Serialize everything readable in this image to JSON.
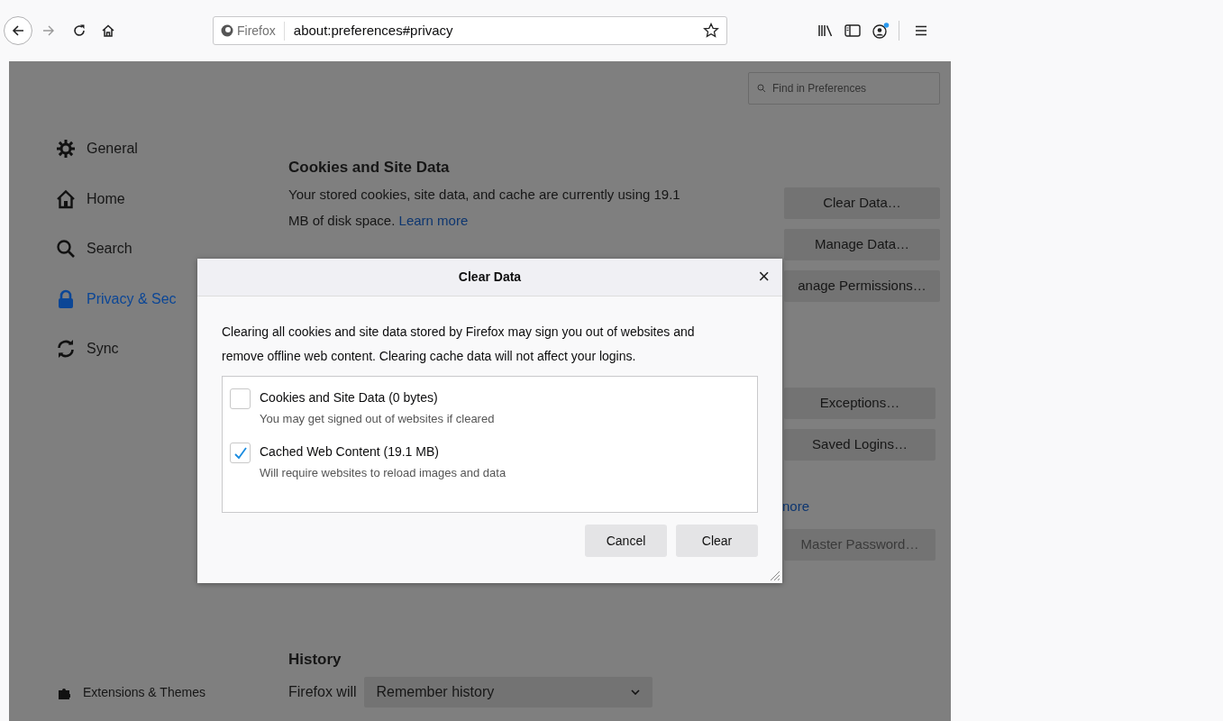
{
  "toolbar": {
    "identity": "Firefox",
    "url": "about:preferences#privacy"
  },
  "search": {
    "placeholder": "Find in Preferences"
  },
  "sidebar": {
    "items": [
      {
        "label": "General",
        "kind": "gear",
        "selected": false
      },
      {
        "label": "Home",
        "kind": "home",
        "selected": false
      },
      {
        "label": "Search",
        "kind": "search",
        "selected": false
      },
      {
        "label": "Privacy & Sec",
        "kind": "lock",
        "selected": true
      },
      {
        "label": "Sync",
        "kind": "sync",
        "selected": false
      }
    ],
    "footer": "Extensions & Themes"
  },
  "cookies": {
    "heading": "Cookies and Site Data",
    "text": "Your stored cookies, site data, and cache are currently using 19.1 MB of disk space.",
    "link": "Learn more",
    "buttons": [
      "Clear Data…",
      "Manage Data…",
      "anage Permissions…"
    ]
  },
  "logins": {
    "buttons": [
      "Exceptions…",
      "Saved Logins…"
    ],
    "link": "nore",
    "master_button": {
      "label": "Master Password…",
      "disabled": true
    }
  },
  "history": {
    "heading": "History",
    "label": "Firefox will",
    "select": "Remember history"
  },
  "dialog": {
    "title": "Clear Data",
    "close": "×",
    "text": "Clearing all cookies and site data stored by Firefox may sign you out of websites and remove offline web content. Clearing cache data will not affect your logins.",
    "options": [
      {
        "label": "Cookies and Site Data (0 bytes)",
        "description": "You may get signed out of websites if cleared",
        "checked": false
      },
      {
        "label": "Cached Web Content (19.1 MB)",
        "description": "Will require websites to reload images and data",
        "checked": true
      }
    ],
    "buttons": [
      "Cancel",
      "Clear"
    ]
  }
}
